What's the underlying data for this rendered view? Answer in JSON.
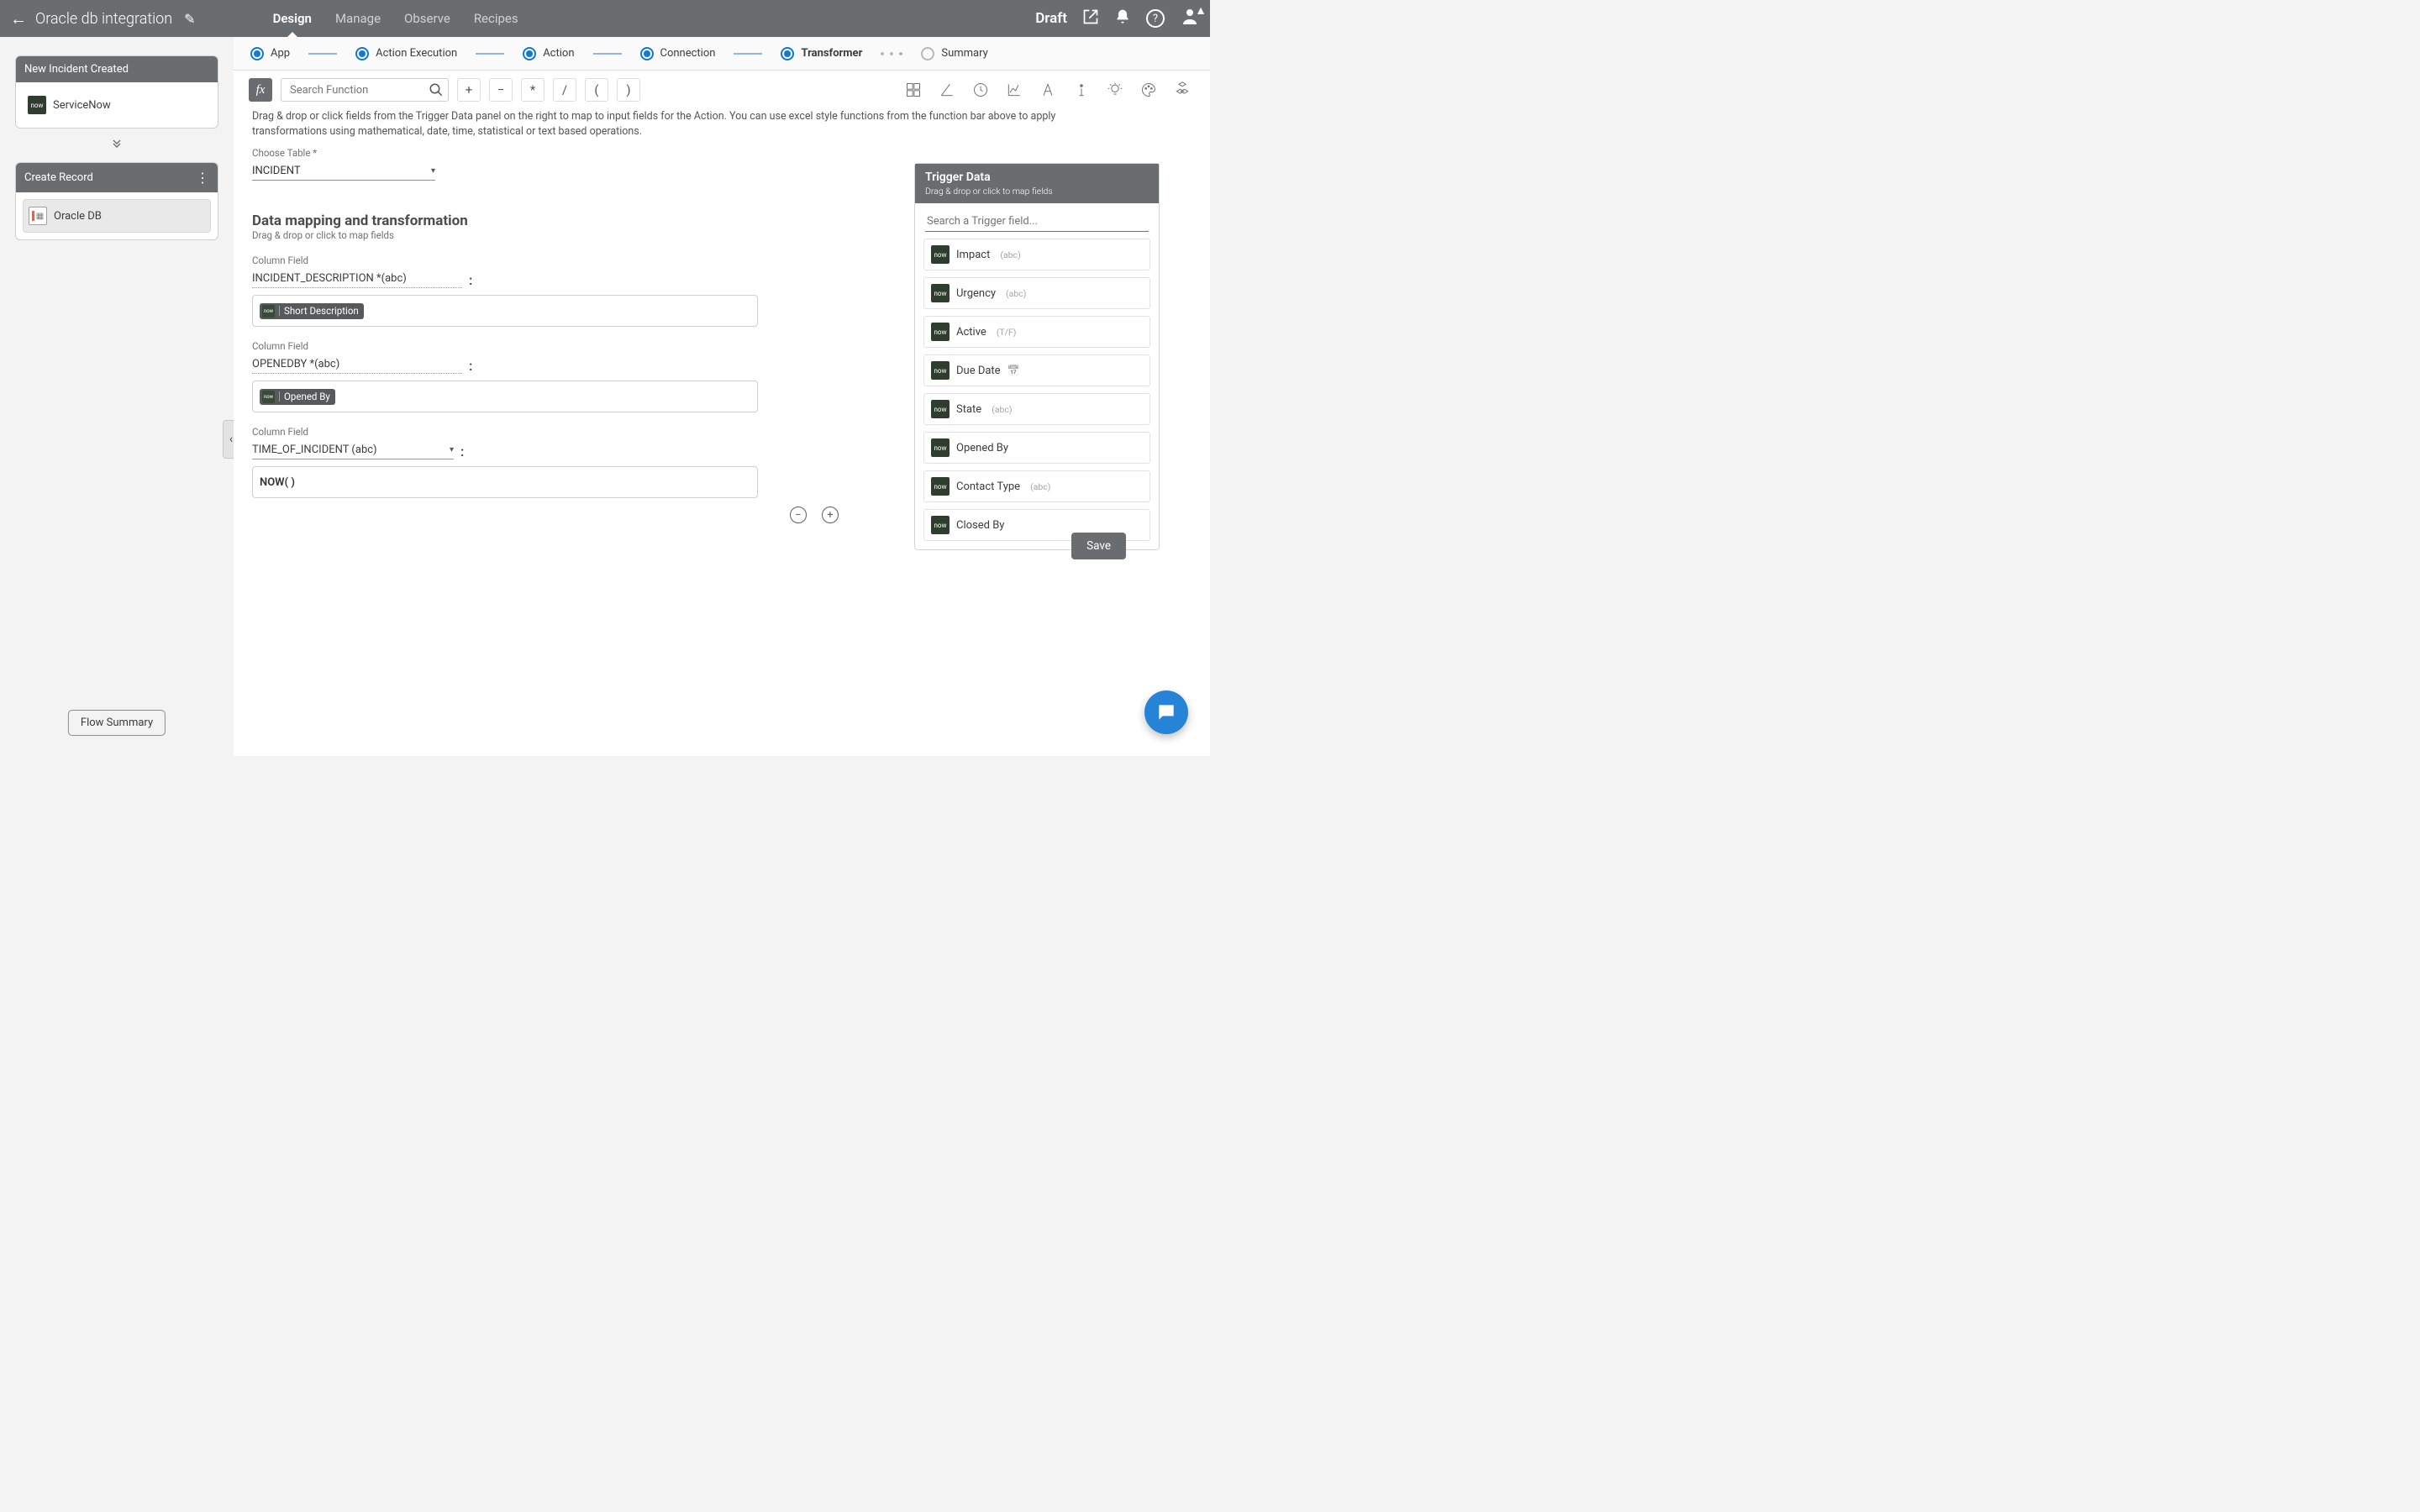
{
  "header": {
    "title": "Oracle db integration",
    "status": "Draft",
    "tabs": [
      "Design",
      "Manage",
      "Observe",
      "Recipes"
    ],
    "active_tab": "Design"
  },
  "sidebar": {
    "trigger_card_title": "New Incident Created",
    "trigger_source": "ServiceNow",
    "action_card_title": "Create Record",
    "action_source": "Oracle DB",
    "summary_button": "Flow Summary"
  },
  "steps": {
    "items": [
      "App",
      "Action Execution",
      "Action",
      "Connection",
      "Transformer",
      "Summary"
    ],
    "active": "Transformer"
  },
  "function_bar": {
    "search_placeholder": "Search Function",
    "ops": [
      "+",
      "−",
      "*",
      "/",
      "(",
      ")"
    ]
  },
  "info_text": "Drag & drop or click fields from the Trigger Data panel on the right to map to input fields for the Action. You can use excel style functions from the function bar above to apply transformations using mathematical, date, time, statistical or text based operations.",
  "choose_table": {
    "label": "Choose Table *",
    "value": "INCIDENT"
  },
  "mapping": {
    "title": "Data mapping and transformation",
    "subtitle": "Drag & drop or click to map fields",
    "column_label": "Column Field",
    "rows": [
      {
        "column": "INCIDENT_DESCRIPTION *(abc)",
        "value_type": "token",
        "token_text": "Short Description"
      },
      {
        "column": "OPENEDBY *(abc)",
        "value_type": "token",
        "token_text": "Opened By"
      },
      {
        "column": "TIME_OF_INCIDENT (abc)",
        "value_type": "text",
        "text_value": "NOW( )"
      }
    ]
  },
  "trigger_panel": {
    "title": "Trigger Data",
    "subtitle": "Drag & drop or click to map fields",
    "search_placeholder": "Search a Trigger field...",
    "fields": [
      {
        "name": "Impact",
        "type": "(abc)"
      },
      {
        "name": "Urgency",
        "type": "(abc)"
      },
      {
        "name": "Active",
        "type": "(T/F)"
      },
      {
        "name": "Due Date",
        "type": "date"
      },
      {
        "name": "State",
        "type": "(abc)"
      },
      {
        "name": "Opened By",
        "type": ""
      },
      {
        "name": "Contact Type",
        "type": "(abc)"
      },
      {
        "name": "Closed By",
        "type": ""
      }
    ],
    "save_button": "Save"
  }
}
